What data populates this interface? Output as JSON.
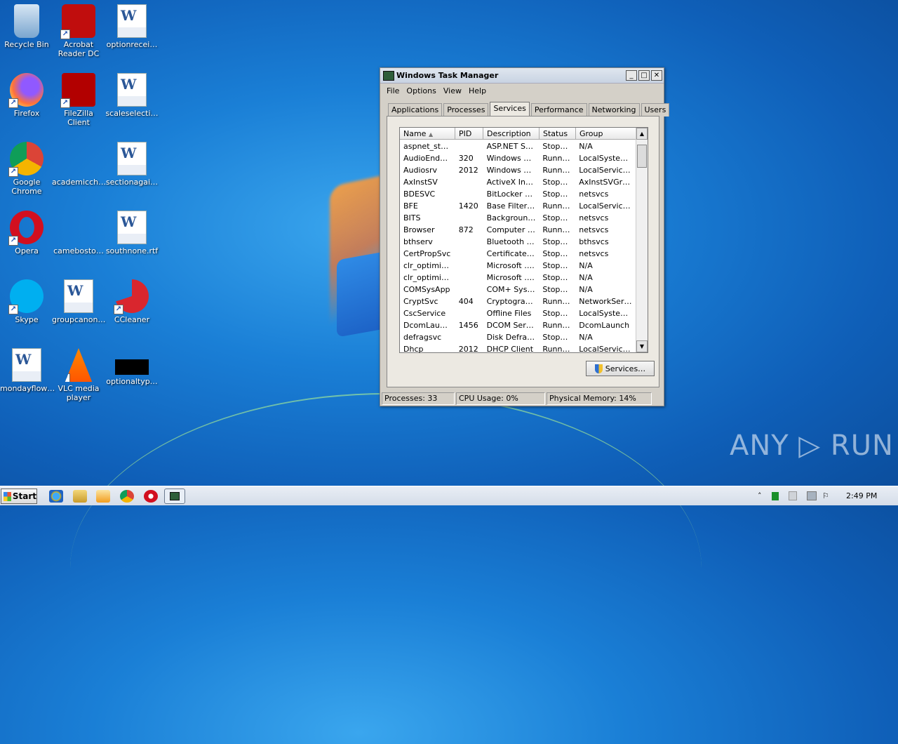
{
  "desktop": {
    "icons": [
      {
        "label": "Recycle Bin",
        "icon": "recycle-bin-icon"
      },
      {
        "label": "Acrobat Reader DC",
        "icon": "acrobat-reader-icon"
      },
      {
        "label": "optionrecei…",
        "icon": "word-document-icon"
      },
      {
        "label": "Firefox",
        "icon": "firefox-icon"
      },
      {
        "label": "FileZilla Client",
        "icon": "filezilla-icon"
      },
      {
        "label": "scaleselecti…",
        "icon": "word-document-icon"
      },
      {
        "label": "Google Chrome",
        "icon": "chrome-icon"
      },
      {
        "label": "academicch…",
        "icon": "file-icon"
      },
      {
        "label": "sectionagai…",
        "icon": "word-document-icon"
      },
      {
        "label": "Opera",
        "icon": "opera-icon"
      },
      {
        "label": "camebosto…",
        "icon": "file-icon"
      },
      {
        "label": "southnone.rtf",
        "icon": "word-document-icon"
      },
      {
        "label": "Skype",
        "icon": "skype-icon"
      },
      {
        "label": "groupcanon…",
        "icon": "word-document-icon"
      },
      {
        "label": "CCleaner",
        "icon": "ccleaner-icon"
      },
      {
        "label": "mondayflow…",
        "icon": "word-document-icon"
      },
      {
        "label": "VLC media player",
        "icon": "vlc-icon"
      },
      {
        "label": "optionaltyp…",
        "icon": "black-file-icon"
      }
    ]
  },
  "window": {
    "title": "Windows Task Manager",
    "buttons": {
      "minimize": "_",
      "maximize": "□",
      "close": "✕"
    },
    "menu": [
      "File",
      "Options",
      "View",
      "Help"
    ],
    "tabs": [
      "Applications",
      "Processes",
      "Services",
      "Performance",
      "Networking",
      "Users"
    ],
    "active_tab": "Services",
    "columns": {
      "name": "Name",
      "pid": "PID",
      "description": "Description",
      "status": "Status",
      "group": "Group"
    },
    "services": [
      {
        "name": "aspnet_state",
        "pid": "",
        "description": "ASP.NET St…",
        "status": "Stopped",
        "group": "N/A"
      },
      {
        "name": "AudioEndpoi…",
        "pid": "320",
        "description": "Windows A…",
        "status": "Running",
        "group": "LocalSyste…"
      },
      {
        "name": "Audiosrv",
        "pid": "2012",
        "description": "Windows A…",
        "status": "Running",
        "group": "LocalServic…"
      },
      {
        "name": "AxInstSV",
        "pid": "",
        "description": "ActiveX Ins…",
        "status": "Stopped",
        "group": "AxInstSVGr…"
      },
      {
        "name": "BDESVC",
        "pid": "",
        "description": "BitLocker D…",
        "status": "Stopped",
        "group": "netsvcs"
      },
      {
        "name": "BFE",
        "pid": "1420",
        "description": "Base Filteri…",
        "status": "Running",
        "group": "LocalServic…"
      },
      {
        "name": "BITS",
        "pid": "",
        "description": "Background…",
        "status": "Stopped",
        "group": "netsvcs"
      },
      {
        "name": "Browser",
        "pid": "872",
        "description": "Computer B…",
        "status": "Running",
        "group": "netsvcs"
      },
      {
        "name": "bthserv",
        "pid": "",
        "description": "Bluetooth S…",
        "status": "Stopped",
        "group": "bthsvcs"
      },
      {
        "name": "CertPropSvc",
        "pid": "",
        "description": "Certificate …",
        "status": "Stopped",
        "group": "netsvcs"
      },
      {
        "name": "clr_optimiza…",
        "pid": "",
        "description": "Microsoft ….",
        "status": "Stopped",
        "group": "N/A"
      },
      {
        "name": "clr_optimiza…",
        "pid": "",
        "description": "Microsoft ….",
        "status": "Stopped",
        "group": "N/A"
      },
      {
        "name": "COMSysApp",
        "pid": "",
        "description": "COM+ Syst…",
        "status": "Stopped",
        "group": "N/A"
      },
      {
        "name": "CryptSvc",
        "pid": "404",
        "description": "Cryptograp…",
        "status": "Running",
        "group": "NetworkSer…"
      },
      {
        "name": "CscService",
        "pid": "",
        "description": "Offline Files",
        "status": "Stopped",
        "group": "LocalSyste…"
      },
      {
        "name": "DcomLaunch",
        "pid": "1456",
        "description": "DCOM Serv…",
        "status": "Running",
        "group": "DcomLaunch"
      },
      {
        "name": "defragsvc",
        "pid": "",
        "description": "Disk Defrag…",
        "status": "Stopped",
        "group": "N/A"
      },
      {
        "name": "Dhcp",
        "pid": "2012",
        "description": "DHCP Client",
        "status": "Running",
        "group": "LocalServic…"
      }
    ],
    "services_button": "Services…",
    "status": {
      "processes": "Processes: 33",
      "cpu": "CPU Usage: 0%",
      "memory": "Physical Memory: 14%"
    }
  },
  "taskbar": {
    "start_label": "Start",
    "pinned": [
      "ie-icon",
      "explorer-icon",
      "media-player-icon",
      "chrome-icon",
      "opera-icon",
      "task-manager-icon"
    ],
    "clock": "2:49 PM"
  },
  "watermark": "ANY ▷ RUN"
}
